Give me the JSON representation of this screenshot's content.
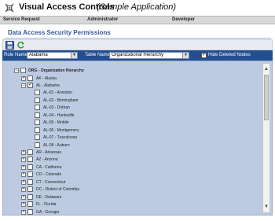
{
  "header": {
    "title": "Visual Access Controls",
    "subtitle": "(Sample Application)"
  },
  "menu": [
    "Service Request",
    "Administrator",
    "Developer"
  ],
  "page_title": "Data Access Security Permissions",
  "toolbar": {
    "icons": [
      "save-icon",
      "refresh-icon"
    ]
  },
  "filters": {
    "role_label": "Role Name",
    "role_value": "Alabama",
    "table_label": "Table Name",
    "table_value": "Organizational Hierarchy",
    "hide_deleted_label": "Hide Deleted Nodes",
    "hide_deleted_checked": true
  },
  "tree": {
    "root": "ORG - Organization Hierarchy",
    "rows": [
      {
        "label": "AK - Alaska",
        "checked": false
      },
      {
        "label": "AL - Alabama",
        "checked": true
      },
      {
        "label": "AL-01 - Anniston",
        "checked": false
      },
      {
        "label": "AL-02 - Birmingham",
        "checked": false
      },
      {
        "label": "AL-03 - Dothan",
        "checked": false
      },
      {
        "label": "AL-04 - Huntsville",
        "checked": false
      },
      {
        "label": "AL-05 - Mobile",
        "checked": false
      },
      {
        "label": "AL-06 - Montgomery",
        "checked": false
      },
      {
        "label": "AL-07 - Tuscaloosa",
        "checked": false
      },
      {
        "label": "AL-08 - Auburn",
        "checked": false
      },
      {
        "label": "AR - Arkansas",
        "checked": false
      },
      {
        "label": "AZ - Arizona",
        "checked": false
      },
      {
        "label": "CA - California",
        "checked": false
      },
      {
        "label": "CO - Colorado",
        "checked": false
      },
      {
        "label": "CT - Connecticut",
        "checked": false
      },
      {
        "label": "DC - District of Colombia",
        "checked": false
      },
      {
        "label": "DE - Delaware",
        "checked": false
      },
      {
        "label": "FL - Florida",
        "checked": false
      },
      {
        "label": "GA - Georgia",
        "checked": false
      }
    ]
  },
  "colors": {
    "title_blue": "#2f5b9c",
    "filter_bar": "#234e8f",
    "tree_bg": "#bccbe2"
  }
}
